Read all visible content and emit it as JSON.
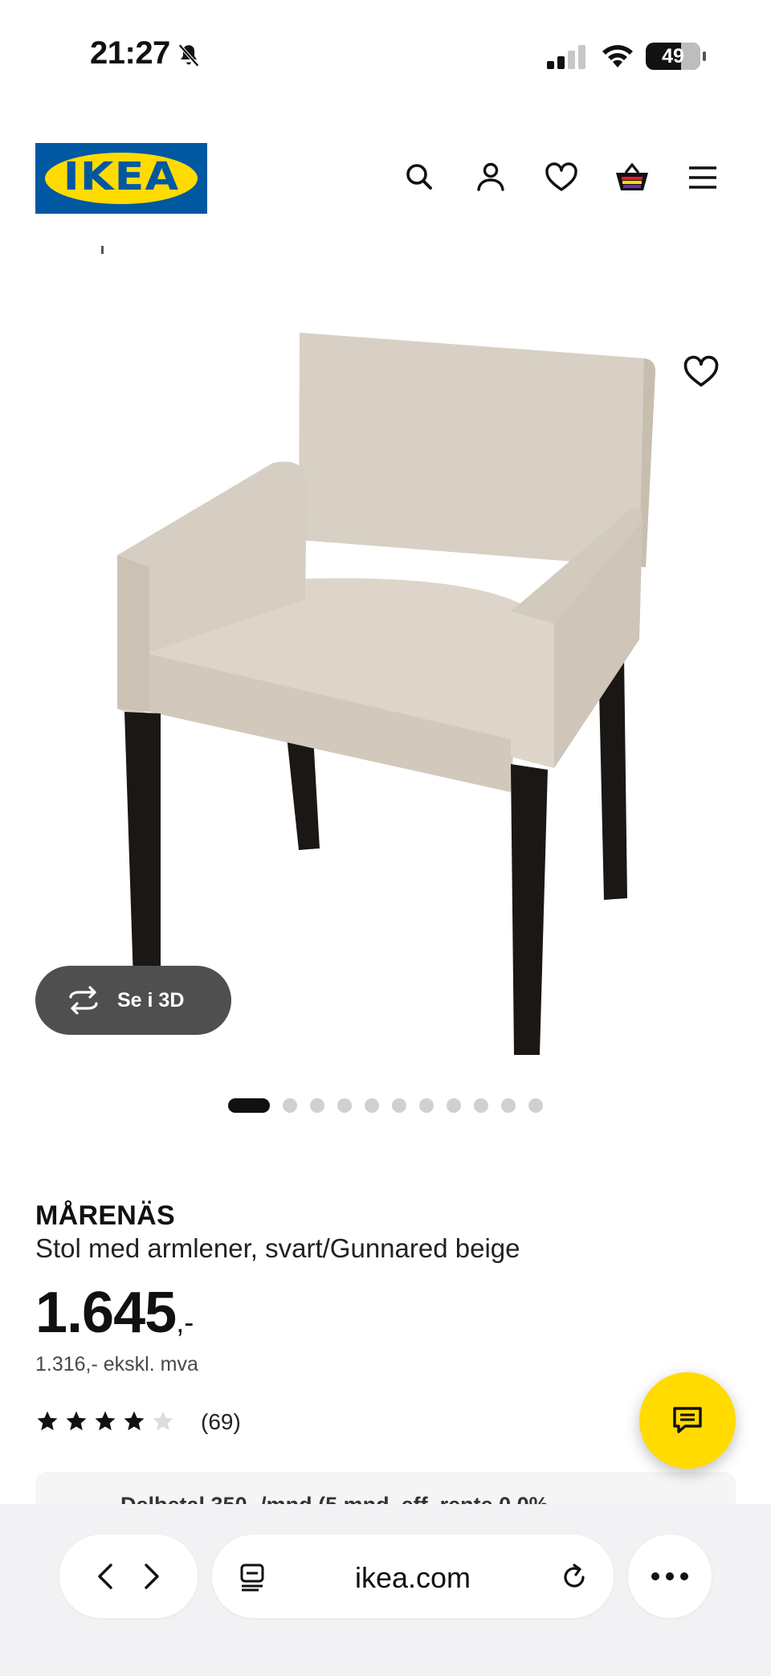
{
  "status_bar": {
    "time": "21:27",
    "battery": "49"
  },
  "header": {
    "logo_text": "IKEA",
    "icons": [
      "search-icon",
      "account-icon",
      "favourites-icon",
      "cart-icon",
      "menu-icon"
    ]
  },
  "gallery": {
    "view_3d_label": "Se i 3D",
    "slide_count": 12,
    "active_slide": 1
  },
  "product": {
    "name": "MÅRENÄS",
    "description": "Stol med armlener, svart/Gunnared beige",
    "price_main": "1.645",
    "price_suffix": ",-",
    "price_ex_vat": "1.316,- ekskl. mva",
    "rating": 4,
    "rating_max": 5,
    "review_count": "(69)"
  },
  "promo": {
    "text": "Delbetal 350,-/mnd (5 mnd, eff. rente 0,0%"
  },
  "browser": {
    "url": "ikea.com"
  },
  "colors": {
    "ikea_blue": "#0058a3",
    "ikea_yellow": "#ffdb00"
  }
}
